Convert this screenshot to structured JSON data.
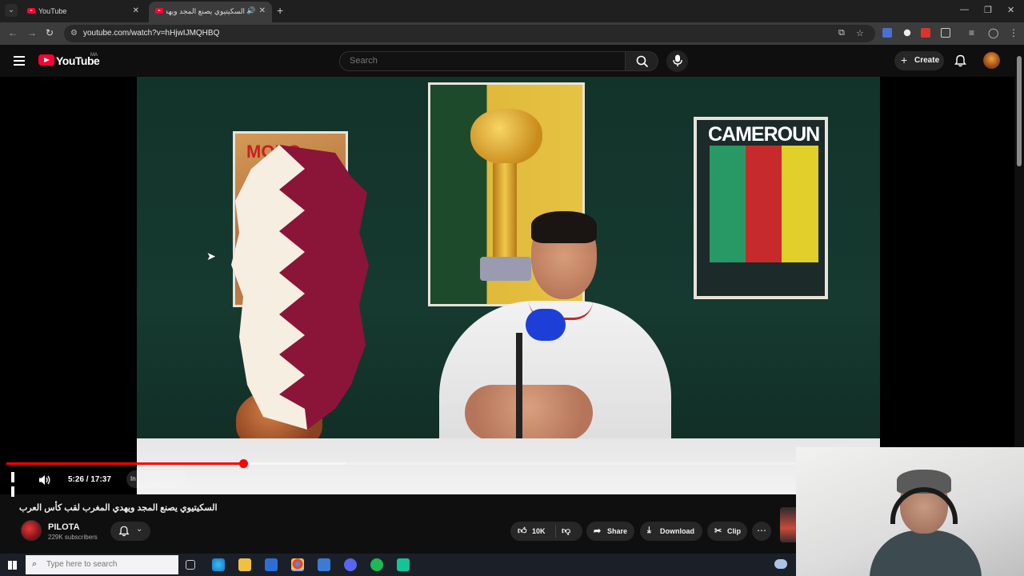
{
  "browser": {
    "tabs": [
      {
        "title": "YouTube",
        "active": false
      },
      {
        "title": "السكيتيوي يصنع المجد ويهدي",
        "active": true
      }
    ],
    "url": "youtube.com/watch?v=hHjwIJMQHBQ"
  },
  "youtube": {
    "logo_text": "YouTube",
    "country_code": "MA",
    "search_placeholder": "Search",
    "create_label": "Create"
  },
  "player": {
    "time": "5:26 / 17:37",
    "chapter_chip": "In this video",
    "played_fraction": 0.3,
    "buffered_fraction": 0.43,
    "poster_left_text": "MORO",
    "poster_right_text": "CAMEROUN"
  },
  "video": {
    "title": "السكيتيوي يصنع المجد ويهدي المغرب لقب كأس العرب",
    "channel": "PILOTA",
    "subscribers": "229K subscribers",
    "likes": "10K",
    "share_label": "Share",
    "download_label": "Download",
    "clip_label": "Clip"
  },
  "taskbar": {
    "search_placeholder": "Type here to search"
  },
  "colors": {
    "accent_red": "#ff0000",
    "bg": "#0f0f0f"
  }
}
